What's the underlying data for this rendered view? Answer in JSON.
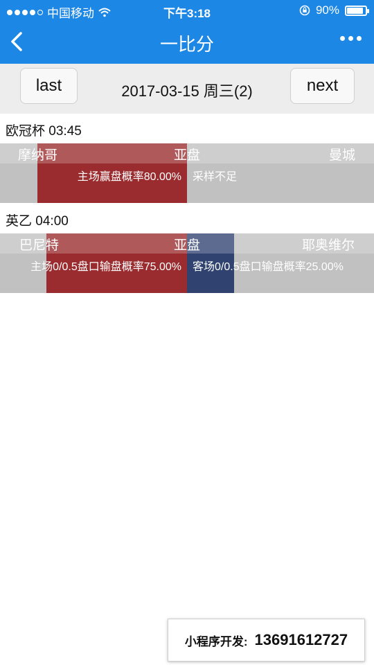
{
  "status_bar": {
    "carrier": "中国移动",
    "time": "下午3:18",
    "battery_text": "90%",
    "battery_level": 0.9
  },
  "nav": {
    "title": "一比分"
  },
  "date_bar": {
    "prev_label": "last",
    "date": "2017-03-15 周三(2)",
    "next_label": "next"
  },
  "matches": [
    {
      "league_time": "欧冠杯 03:45",
      "home": "摩纳哥",
      "market": "亚盘",
      "away": "曼城",
      "home_prob_text": "主场赢盘概率80.00%",
      "away_prob_text": "采样不足",
      "home_prob": 0.8,
      "away_prob": 0.0,
      "home_color": "#9a2b2e",
      "away_color": "#2f4270"
    },
    {
      "league_time": "英乙 04:00",
      "home": "巴尼特",
      "market": "亚盘",
      "away": "耶奥维尔",
      "home_prob_text": "主场0/0.5盘口输盘概率75.00%",
      "away_prob_text": "客场0/0.5盘口输盘概率25.00%",
      "home_prob": 0.75,
      "away_prob": 0.25,
      "home_color": "#9a2b2e",
      "away_color": "#2f4270"
    }
  ],
  "promo": {
    "label": "小程序开发:",
    "phone": "13691612727"
  }
}
